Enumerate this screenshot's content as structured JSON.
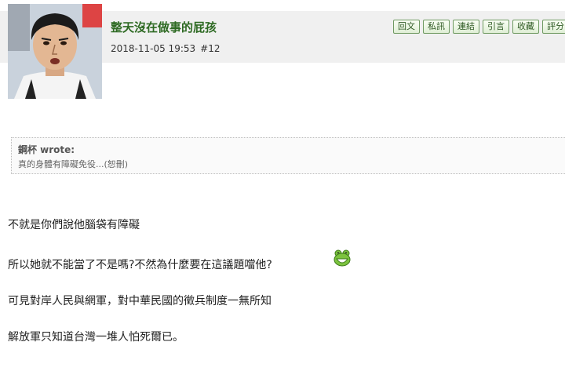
{
  "post": {
    "username": "整天沒在做事的屁孩",
    "timestamp": "2018-11-05 19:53",
    "floor": "#12"
  },
  "actions": [
    {
      "label": "回文"
    },
    {
      "label": "私訊"
    },
    {
      "label": "連結"
    },
    {
      "label": "引言"
    },
    {
      "label": "收藏"
    },
    {
      "label": "評分"
    },
    {
      "label": ""
    }
  ],
  "quote": {
    "author": "鋼杯 wrote:",
    "text": "真的身體有障礙免役...(恕刪)"
  },
  "body": [
    "不就是你們說他腦袋有障礙",
    "所以她就不能當了不是嗎?不然為什麼要在這議題噹他?",
    "可見對岸人民與網軍，對中華民國的徵兵制度一無所知",
    "解放軍只知道台灣一堆人怕死爾已。"
  ],
  "emoji": "laughing-frog-emoticon",
  "colors": {
    "username": "#2e6a23",
    "button_border": "#6f9a62",
    "header_band": "#f0f0f0"
  }
}
